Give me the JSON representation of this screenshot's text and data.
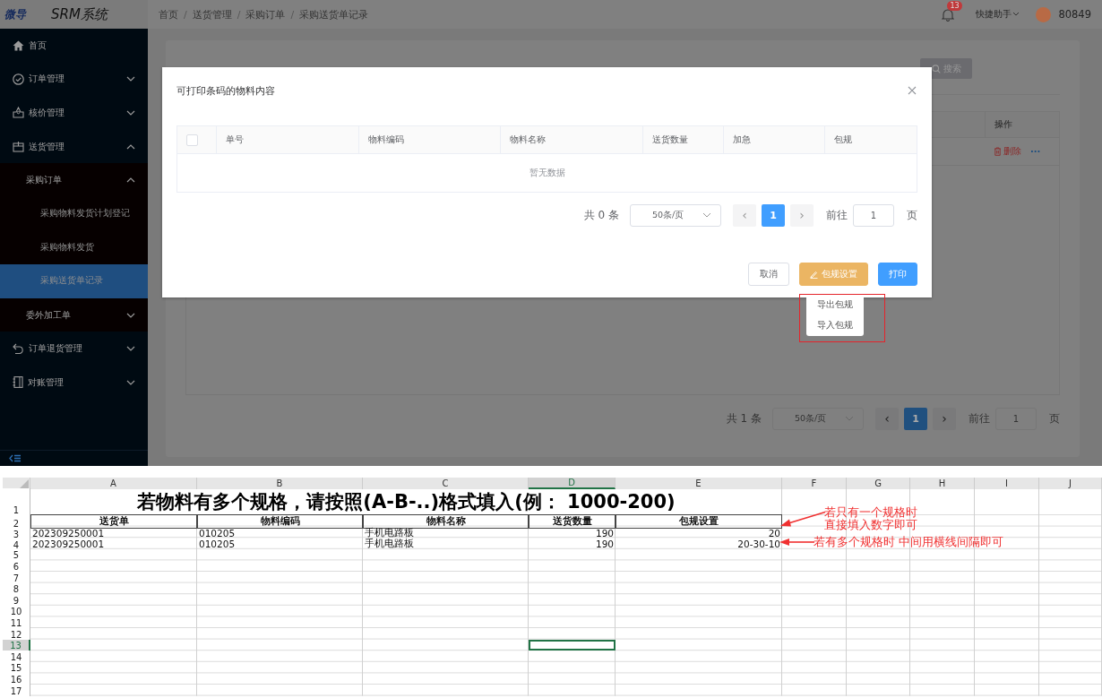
{
  "header": {
    "logo": "微导",
    "system_name": "SRM系统",
    "breadcrumbs": [
      "首页",
      "送货管理",
      "采购订单",
      "采购送货单记录"
    ],
    "breadcrumb_separator": "/",
    "notification_count": "13",
    "quick_help": "快捷助手",
    "user_name": "80849"
  },
  "sidebar": {
    "items": [
      {
        "label": "首页",
        "kind": "link",
        "selected": false
      },
      {
        "label": "订单管理",
        "kind": "group",
        "expanded": false
      },
      {
        "label": "核价管理",
        "kind": "group",
        "expanded": false
      },
      {
        "label": "送货管理",
        "kind": "group",
        "expanded": true,
        "children": [
          {
            "label": "采购订单",
            "kind": "group",
            "expanded": true,
            "children": [
              {
                "label": "采购物料发货计划登记",
                "kind": "link",
                "selected": false
              },
              {
                "label": "采购物料发货",
                "kind": "link",
                "selected": false
              },
              {
                "label": "采购送货单记录",
                "kind": "link",
                "selected": true
              }
            ]
          },
          {
            "label": "委外加工单",
            "kind": "group",
            "expanded": false
          }
        ]
      },
      {
        "label": "订单退货管理",
        "kind": "group",
        "expanded": false
      },
      {
        "label": "对账管理",
        "kind": "group",
        "expanded": false
      }
    ]
  },
  "page": {
    "search_button": "搜索",
    "table": {
      "columns": [
        "操作"
      ],
      "rows": [
        {
          "actions": [
            "删除",
            "···"
          ]
        }
      ]
    },
    "pagination": {
      "total": "共 1 条",
      "page_size": "50条/页",
      "prev": "‹",
      "next": "›",
      "pages": [
        {
          "label": "1",
          "selected": true
        }
      ],
      "goto_label": "前往",
      "goto_value": "1",
      "page_unit": "页"
    }
  },
  "dialog": {
    "title": "可打印条码的物料内容",
    "columns": [
      "单号",
      "物料编码",
      "物料名称",
      "送货数量",
      "加急",
      "包规"
    ],
    "select_all_checked": false,
    "empty_text": "暂无数据",
    "pagination": {
      "total": "共 0 条",
      "page_size": "50条/页",
      "prev": "‹",
      "next": "›",
      "pages": [
        {
          "label": "1",
          "selected": true
        }
      ],
      "goto_label": "前往",
      "goto_value": "1",
      "page_unit": "页"
    },
    "buttons": [
      {
        "label": "取消",
        "kind": "default"
      },
      {
        "label": "包规设置",
        "kind": "warning"
      },
      {
        "label": "打印",
        "kind": "primary"
      }
    ],
    "dropdown": {
      "items": [
        "导出包规",
        "导入包规"
      ]
    }
  },
  "spreadsheet": {
    "columns": [
      {
        "label": "A",
        "selected": false
      },
      {
        "label": "B",
        "selected": false
      },
      {
        "label": "C",
        "selected": false
      },
      {
        "label": "D",
        "selected": true
      },
      {
        "label": "E",
        "selected": false
      },
      {
        "label": "F",
        "selected": false
      },
      {
        "label": "G",
        "selected": false
      },
      {
        "label": "H",
        "selected": false
      },
      {
        "label": "I",
        "selected": false
      },
      {
        "label": "J",
        "selected": false
      }
    ],
    "rows": [
      {
        "number": "1",
        "selected": false,
        "kind": "title",
        "text": "若物料有多个规格，请按照(A-B-..)格式填入(例： 1000-200)"
      },
      {
        "number": "2",
        "selected": false,
        "kind": "header",
        "cells": [
          "送货单",
          "物料编码",
          "物料名称",
          "送货数量",
          "包规设置"
        ]
      },
      {
        "number": "3",
        "selected": false,
        "kind": "data",
        "cells": [
          "202309250001",
          "010205",
          "手机电路板",
          "190",
          "20"
        ]
      },
      {
        "number": "4",
        "selected": false,
        "kind": "data",
        "cells": [
          "202309250001",
          "010205",
          "手机电路板",
          "190",
          "20-30-10"
        ]
      },
      {
        "number": "5",
        "selected": false,
        "kind": "empty"
      },
      {
        "number": "6",
        "selected": false,
        "kind": "empty"
      },
      {
        "number": "7",
        "selected": false,
        "kind": "empty"
      },
      {
        "number": "8",
        "selected": false,
        "kind": "empty"
      },
      {
        "number": "9",
        "selected": false,
        "kind": "empty"
      },
      {
        "number": "10",
        "selected": false,
        "kind": "empty"
      },
      {
        "number": "11",
        "selected": false,
        "kind": "empty"
      },
      {
        "number": "12",
        "selected": false,
        "kind": "empty"
      },
      {
        "number": "13",
        "selected": true,
        "kind": "empty"
      },
      {
        "number": "14",
        "selected": false,
        "kind": "empty"
      },
      {
        "number": "15",
        "selected": false,
        "kind": "empty"
      },
      {
        "number": "16",
        "selected": false,
        "kind": "empty"
      },
      {
        "number": "17",
        "selected": false,
        "kind": "empty"
      }
    ],
    "annotations": [
      {
        "lines": [
          "若只有一个规格时",
          "直接填入数字即可"
        ]
      },
      {
        "lines": [
          "若有多个规格时 中间用横线间隔即可"
        ]
      }
    ]
  }
}
